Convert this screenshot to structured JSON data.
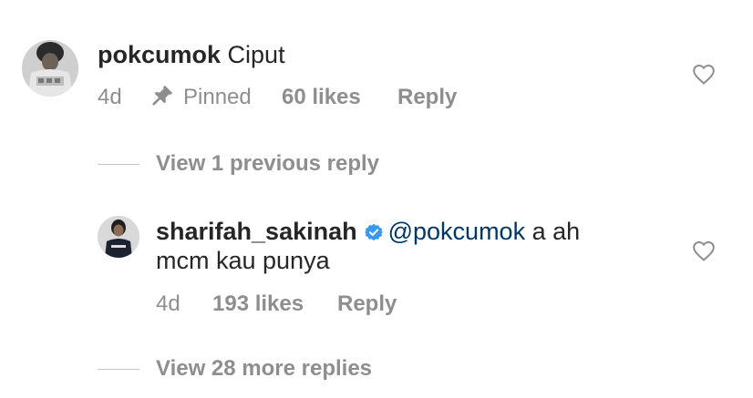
{
  "comment": {
    "username": "pokcumok",
    "text": "Ciput",
    "time": "4d",
    "pinned_label": "Pinned",
    "likes": "60 likes",
    "reply_label": "Reply"
  },
  "view_previous": "View 1 previous reply",
  "reply": {
    "username": "sharifah_sakinah",
    "mention": "@pokcumok",
    "text_line1": "a ah",
    "text_line2": "mcm kau punya",
    "time": "4d",
    "likes": "193 likes",
    "reply_label": "Reply"
  },
  "view_more": "View 28 more replies",
  "icons": {
    "pin": "pin-icon",
    "heart": "heart-outline-icon",
    "verified": "verified-badge-icon"
  },
  "colors": {
    "text": "#262626",
    "secondary": "#8e8e8e",
    "mention": "#00376b",
    "verified": "#3897f0"
  }
}
